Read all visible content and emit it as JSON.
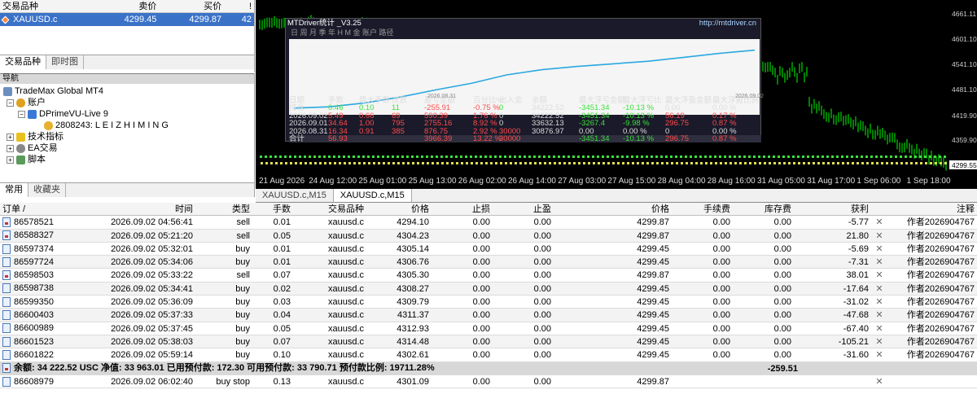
{
  "market_watch": {
    "headers": [
      "交易品种",
      "卖价",
      "买价",
      "!"
    ],
    "row": {
      "symbol": "XAUUSD.c",
      "bid": "4299.45",
      "ask": "4299.87",
      "spread": "42"
    },
    "tabs": [
      "交易品种",
      "即时图"
    ]
  },
  "navigator": {
    "title": "导航",
    "items": [
      "TradeMax Global MT4",
      "账户",
      "DPrimeVU-Live 9",
      "2808243: L E I Z H I M I N G",
      "技术指标",
      "EA交易",
      "脚本"
    ],
    "tabs": [
      "常用",
      "收藏夹"
    ]
  },
  "chart": {
    "price_labels": [
      "4661.11",
      "4601.10",
      "4541.10",
      "4481.10",
      "4419.90",
      "4359.90",
      "4299.55"
    ],
    "time_labels": [
      "21 Aug 2026",
      "24 Aug 12:00",
      "25 Aug 01:00",
      "25 Aug 13:00",
      "26 Aug 02:00",
      "26 Aug 14:00",
      "27 Aug 03:00",
      "27 Aug 15:00",
      "28 Aug 04:00",
      "28 Aug 16:00",
      "31 Aug 05:00",
      "31 Aug 17:00",
      "1 Sep 06:00",
      "1 Sep 18:00"
    ],
    "tabs": [
      "XAUUSD.c,M15",
      "XAUUSD.c,M15"
    ],
    "colors": {
      "bg": "#000000",
      "candles": "#00ff00",
      "ea_line": "#3ce03c"
    }
  },
  "mtdriver": {
    "title": "MTDriver统计 _V3.25",
    "url": "http://mtdriver.cn",
    "menu": "日 周 月 季 年 H M 金 账户      路径",
    "plot_dates": [
      "2026.08.31",
      "2026.09.02"
    ],
    "headers": [
      "日期",
      "手数",
      "最大手数",
      "次数",
      "盈亏金额",
      "百分比%",
      "出入金",
      "余额",
      "最大浮亏金额",
      "最大浮亏比",
      "最大浮盈金额",
      "最大浮盈比例"
    ],
    "rows": [
      [
        "持仓",
        "0.46",
        "0.10",
        "11",
        "-255.91",
        "-0.75 %",
        "0",
        "34222.52",
        "-3451.34",
        "-10.13 %",
        "0.00",
        "0.00 %"
      ],
      [
        "2026.09.02",
        "5.49",
        "0.66",
        "69",
        "590.39",
        "1.76 %",
        "0",
        "34222.52",
        "-3451.34",
        "-10.13 %",
        "56.19",
        "0.17 %"
      ],
      [
        "2026.09.01",
        "34.64",
        "1.00",
        "795",
        "2755.16",
        "8.92 %",
        "0",
        "33632.13",
        "-3267.4",
        "-9.98 %",
        "296.75",
        "0.87 %"
      ],
      [
        "2026.08.31",
        "16.34",
        "0.91",
        "385",
        "876.75",
        "2.92 %",
        "30000",
        "30876.97",
        "0.00",
        "0.00 %",
        "0",
        "0.00 %"
      ],
      [
        "合计",
        "56.93",
        "",
        "",
        "3966.39",
        "13.22 %",
        "30000",
        "",
        "-3451.34",
        "-10.13 %",
        "296.75",
        "0.87 %"
      ]
    ],
    "equity_curve": [
      0.04,
      0.06,
      0.12,
      0.21,
      0.32,
      0.42,
      0.55,
      0.63,
      0.68,
      0.72,
      0.76,
      0.82,
      0.88,
      0.93
    ],
    "line_color": "#29a8e0"
  },
  "orders": {
    "headers": [
      "订单 /",
      "时间",
      "类型",
      "手数",
      "交易品种",
      "价格",
      "止损",
      "止盈",
      "价格",
      "手续费",
      "库存费",
      "获利",
      "",
      "注释"
    ],
    "rows": [
      [
        "86578521",
        "2026.09.02 04:56:41",
        "sell",
        "0.01",
        "xauusd.c",
        "4294.10",
        "0.00",
        "0.00",
        "4299.87",
        "0.00",
        "0.00",
        "-5.77",
        "作者2026904767"
      ],
      [
        "86588327",
        "2026.09.02 05:21:20",
        "sell",
        "0.05",
        "xauusd.c",
        "4304.23",
        "0.00",
        "0.00",
        "4299.87",
        "0.00",
        "0.00",
        "21.80",
        "作者2026904767"
      ],
      [
        "86597374",
        "2026.09.02 05:32:01",
        "buy",
        "0.01",
        "xauusd.c",
        "4305.14",
        "0.00",
        "0.00",
        "4299.45",
        "0.00",
        "0.00",
        "-5.69",
        "作者2026904767"
      ],
      [
        "86597724",
        "2026.09.02 05:34:06",
        "buy",
        "0.01",
        "xauusd.c",
        "4306.76",
        "0.00",
        "0.00",
        "4299.45",
        "0.00",
        "0.00",
        "-7.31",
        "作者2026904767"
      ],
      [
        "86598503",
        "2026.09.02 05:33:22",
        "sell",
        "0.07",
        "xauusd.c",
        "4305.30",
        "0.00",
        "0.00",
        "4299.87",
        "0.00",
        "0.00",
        "38.01",
        "作者2026904767"
      ],
      [
        "86598738",
        "2026.09.02 05:34:41",
        "buy",
        "0.02",
        "xauusd.c",
        "4308.27",
        "0.00",
        "0.00",
        "4299.45",
        "0.00",
        "0.00",
        "-17.64",
        "作者2026904767"
      ],
      [
        "86599350",
        "2026.09.02 05:36:09",
        "buy",
        "0.03",
        "xauusd.c",
        "4309.79",
        "0.00",
        "0.00",
        "4299.45",
        "0.00",
        "0.00",
        "-31.02",
        "作者2026904767"
      ],
      [
        "86600403",
        "2026.09.02 05:37:33",
        "buy",
        "0.04",
        "xauusd.c",
        "4311.37",
        "0.00",
        "0.00",
        "4299.45",
        "0.00",
        "0.00",
        "-47.68",
        "作者2026904767"
      ],
      [
        "86600989",
        "2026.09.02 05:37:45",
        "buy",
        "0.05",
        "xauusd.c",
        "4312.93",
        "0.00",
        "0.00",
        "4299.45",
        "0.00",
        "0.00",
        "-67.40",
        "作者2026904767"
      ],
      [
        "86601523",
        "2026.09.02 05:38:03",
        "buy",
        "0.07",
        "xauusd.c",
        "4314.48",
        "0.00",
        "0.00",
        "4299.45",
        "0.00",
        "0.00",
        "-105.21",
        "作者2026904767"
      ],
      [
        "86601822",
        "2026.09.02 05:59:14",
        "buy",
        "0.10",
        "xauusd.c",
        "4302.61",
        "0.00",
        "0.00",
        "4299.45",
        "0.00",
        "0.00",
        "-31.60",
        "作者2026904767"
      ]
    ],
    "summary": {
      "text": "余额: 34 222.52 USC  净值: 33 963.01  已用预付款: 172.30  可用预付款: 33 790.71  预付款比例: 19711.28%",
      "profit": "-259.51"
    },
    "pending": [
      "86608979",
      "2026.09.02 06:02:40",
      "buy stop",
      "0.13",
      "xauusd.c",
      "4301.09",
      "0.00",
      "0.00",
      "4299.87",
      "",
      "",
      "",
      ""
    ]
  }
}
